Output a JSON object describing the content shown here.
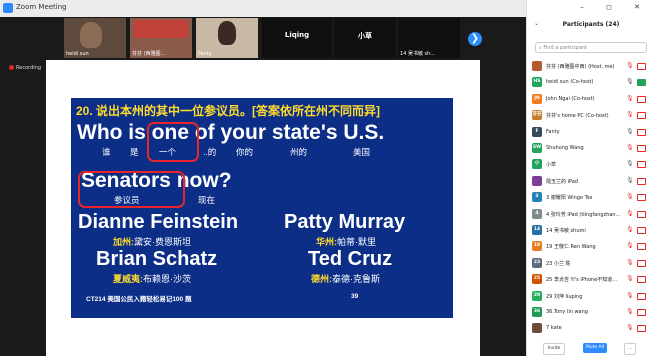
{
  "window": {
    "title": "Zoom Meeting"
  },
  "recording": {
    "label": "Recording"
  },
  "strip": {
    "tiles": [
      {
        "type": "video",
        "name": "heidi sun"
      },
      {
        "type": "video",
        "name": "芬芬 (西雅图...",
        "badge": "⊘"
      },
      {
        "type": "video",
        "name": "Fanty"
      },
      {
        "type": "name",
        "name": "Liqing"
      },
      {
        "type": "name",
        "name": "小草"
      },
      {
        "type": "text",
        "name": "14 吴书敏 sh..."
      }
    ],
    "next_label": "❯"
  },
  "slide": {
    "question": "20. 说出本州的其中一位参议员。[答案依所在州不同而异]",
    "en_line1": "Who is one of your state's U.S.",
    "cn_line1": {
      "w1": "谁",
      "w2": "是",
      "w3": "一个",
      "w4": "..的",
      "w5": "你的",
      "w6": "州的",
      "w7": "美国"
    },
    "en_line2": "Senators now?",
    "cn_line2": {
      "w1": "参议员",
      "w2": "现在"
    },
    "senators": [
      {
        "name": "Dianne Feinstein",
        "state": "加州:",
        "cn": "黛安·费恩斯坦"
      },
      {
        "name": "Patty Murray",
        "state": "华州:",
        "cn": "帕蒂·默里"
      },
      {
        "name": "Brian Schatz",
        "state": "夏威夷:",
        "cn": "布赖恩·沙茨"
      },
      {
        "name": "Ted Cruz",
        "state": "德州:",
        "cn": "泰德·克鲁斯"
      }
    ],
    "footer": "CT214 美国公民入籍轻松易记100 题",
    "page": "39"
  },
  "panel": {
    "title": "Participants (24)",
    "search_placeholder": "Find a participant",
    "participants": [
      {
        "name": "芬芬 (西雅图中西) (Host, me)",
        "avatar": "",
        "color": "#b45a32",
        "mic_on": false,
        "video_on": false
      },
      {
        "name": "heidi sun (Co-host)",
        "avatar": "HS",
        "color": "#23a25e",
        "mic_on": true,
        "video_on": true
      },
      {
        "name": "John Ngai (Co-host)",
        "avatar": "JN",
        "color": "#f07a1e",
        "mic_on": false,
        "video_on": false
      },
      {
        "name": "芬芬's home PC (Co-host)",
        "avatar": "芬芬",
        "color": "#c57d2d",
        "mic_on": false,
        "video_on": false
      },
      {
        "name": "Fanty",
        "avatar": "F",
        "color": "#34495e",
        "mic_on": true,
        "video_on": false
      },
      {
        "name": "Shuhong Wang",
        "avatar": "SW",
        "color": "#23a25e",
        "mic_on": false,
        "video_on": false
      },
      {
        "name": "小草",
        "avatar": "小",
        "color": "#23a25e",
        "mic_on": true,
        "video_on": false
      },
      {
        "name": "隨玉兰的 iPad",
        "avatar": "",
        "color": "#7d3c98",
        "mic_on": true,
        "video_on": false
      },
      {
        "name": "3 谢耀阳 Wingo Tse",
        "avatar": "3",
        "color": "#2980b9",
        "mic_on": false,
        "video_on": false
      },
      {
        "name": "4 张玲芳 iPad (tlingfangzhan...",
        "avatar": "4",
        "color": "#7f8c8d",
        "mic_on": false,
        "video_on": false
      },
      {
        "name": "14 吴书敏 shumi",
        "avatar": "14",
        "color": "#2471a3",
        "mic_on": false,
        "video_on": false
      },
      {
        "name": "19 王敬仁 Ren Wang",
        "avatar": "19",
        "color": "#e67e22",
        "mic_on": false,
        "video_on": false
      },
      {
        "name": "23 小兰 陈",
        "avatar": "23",
        "color": "#5d6d7e",
        "mic_on": false,
        "video_on": false
      },
      {
        "name": "25 李贞吉 Yi's iPhone不知道...",
        "avatar": "25",
        "color": "#d35400",
        "mic_on": false,
        "video_on": false
      },
      {
        "name": "29 刘萍 liuping",
        "avatar": "29",
        "color": "#27ae60",
        "mic_on": false,
        "video_on": false
      },
      {
        "name": "36.Tony lin wang",
        "avatar": "36",
        "color": "#229954",
        "mic_on": false,
        "video_on": false
      },
      {
        "name": "7 kate",
        "avatar": "",
        "color": "#6e4c3a",
        "mic_on": false,
        "video_on": false
      }
    ],
    "invite_label": "Invite",
    "mute_all_label": "Mute All",
    "more_label": "..."
  }
}
